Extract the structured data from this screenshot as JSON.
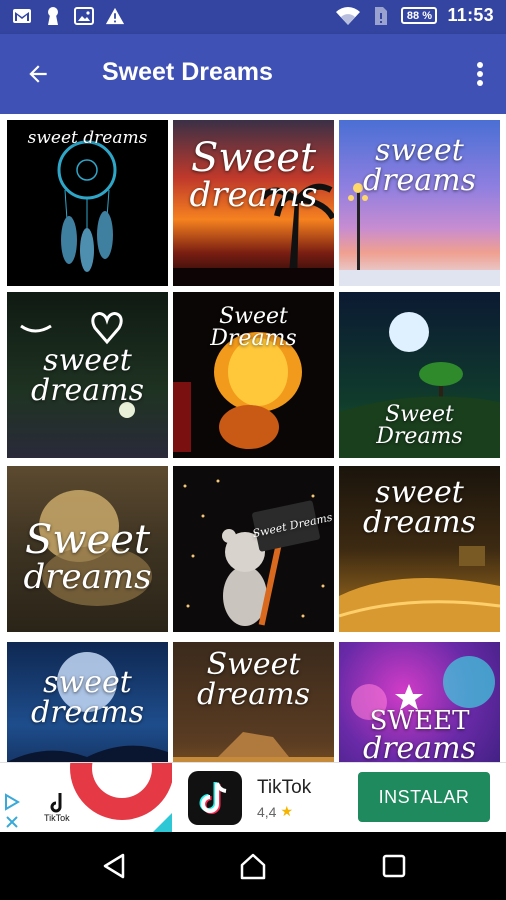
{
  "status_bar": {
    "battery": "88 %",
    "time": "11:53",
    "icons": [
      "gmail-icon",
      "keyhole-icon",
      "image-icon",
      "warning-icon",
      "wifi-icon",
      "sim-icon",
      "battery-icon"
    ]
  },
  "app_bar": {
    "title": "Sweet Dreams",
    "back_icon": "arrow-back-icon",
    "menu_icon": "more-vert-icon"
  },
  "grid": {
    "tiles": [
      {
        "l1": "sweet dreams",
        "l2": ""
      },
      {
        "l1": "Sweet",
        "l2": "dreams"
      },
      {
        "l1": "sweet",
        "l2": "dreams"
      },
      {
        "l1": "sweet",
        "l2": "dreams"
      },
      {
        "l1": "Sweet Dreams",
        "l2": ""
      },
      {
        "l1": "Sweet Dreams",
        "l2": ""
      },
      {
        "l1": "Sweet",
        "l2": "dreams"
      },
      {
        "l1": "Sweet Dreams",
        "l2": ""
      },
      {
        "l1": "sweet",
        "l2": "dreams"
      },
      {
        "l1": "sweet",
        "l2": "dreams"
      },
      {
        "l1": "Sweet",
        "l2": "dreams"
      },
      {
        "l1": "SWEET",
        "l2": "dreams"
      }
    ]
  },
  "ad": {
    "thumb_label": "TikTok",
    "app_name": "TikTok",
    "rating": "4,4",
    "install_label": "INSTALAR"
  },
  "nav_bar": {
    "icons": [
      "back-triangle-icon",
      "home-icon",
      "recents-icon"
    ]
  }
}
